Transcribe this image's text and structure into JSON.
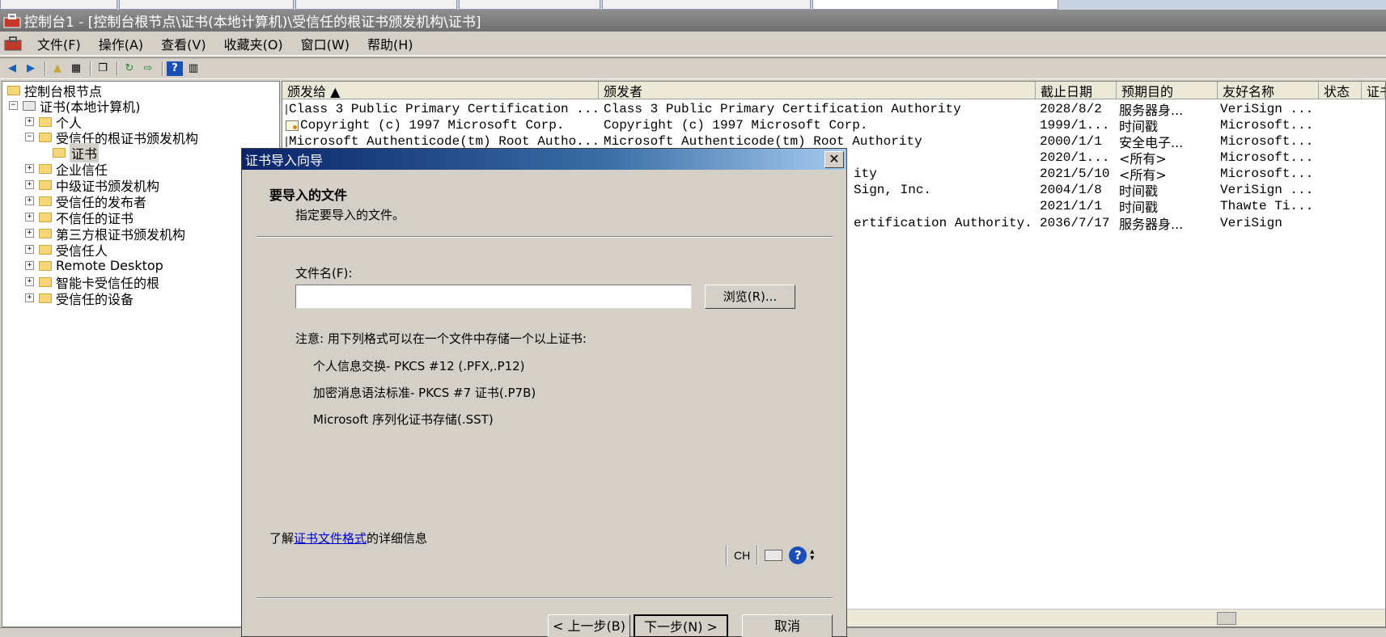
{
  "window": {
    "title": "控制台1 - [控制台根节点\\证书(本地计算机)\\受信任的根证书颁发机构\\证书]"
  },
  "menu": [
    "文件(F)",
    "操作(A)",
    "查看(V)",
    "收藏夹(O)",
    "窗口(W)",
    "帮助(H)"
  ],
  "tree": [
    {
      "label": "控制台根节点",
      "level": 0,
      "expander": "",
      "icon": "folder"
    },
    {
      "label": "证书(本地计算机)",
      "level": 1,
      "expander": "−",
      "icon": "cert-store"
    },
    {
      "label": "个人",
      "level": 2,
      "expander": "+",
      "icon": "folder"
    },
    {
      "label": "受信任的根证书颁发机构",
      "level": 2,
      "expander": "−",
      "icon": "folder"
    },
    {
      "label": "证书",
      "level": 3,
      "expander": "",
      "icon": "folder",
      "selected": true
    },
    {
      "label": "企业信任",
      "level": 2,
      "expander": "+",
      "icon": "folder"
    },
    {
      "label": "中级证书颁发机构",
      "level": 2,
      "expander": "+",
      "icon": "folder"
    },
    {
      "label": "受信任的发布者",
      "level": 2,
      "expander": "+",
      "icon": "folder"
    },
    {
      "label": "不信任的证书",
      "level": 2,
      "expander": "+",
      "icon": "folder"
    },
    {
      "label": "第三方根证书颁发机构",
      "level": 2,
      "expander": "+",
      "icon": "folder"
    },
    {
      "label": "受信任人",
      "level": 2,
      "expander": "+",
      "icon": "folder"
    },
    {
      "label": "Remote Desktop",
      "level": 2,
      "expander": "+",
      "icon": "folder"
    },
    {
      "label": "智能卡受信任的根",
      "level": 2,
      "expander": "+",
      "icon": "folder"
    },
    {
      "label": "受信任的设备",
      "level": 2,
      "expander": "+",
      "icon": "folder"
    }
  ],
  "columns": [
    "颁发给 ▲",
    "颁发者",
    "截止日期",
    "预期目的",
    "友好名称",
    "状态",
    "证书"
  ],
  "rows": [
    {
      "issued_to": "Class 3 Public Primary Certification ...",
      "issued_by": "Class 3 Public Primary Certification Authority",
      "expires": "2028/8/2",
      "purpose": "服务器身...",
      "friendly": "VeriSign ..."
    },
    {
      "issued_to": "Copyright (c) 1997 Microsoft Corp.",
      "issued_by": "Copyright (c) 1997 Microsoft Corp.",
      "expires": "1999/1...",
      "purpose": "时间戳",
      "friendly": "Microsoft..."
    },
    {
      "issued_to": "Microsoft Authenticode(tm) Root Autho...",
      "issued_by": "Microsoft Authenticode(tm) Root Authority",
      "expires": "2000/1/1",
      "purpose": "安全电子...",
      "friendly": "Microsoft..."
    },
    {
      "issued_to": "",
      "issued_by": "",
      "expires": "2020/1...",
      "purpose": "<所有>",
      "friendly": "Microsoft..."
    },
    {
      "issued_to": "",
      "issued_by": "ity",
      "expires": "2021/5/10",
      "purpose": "<所有>",
      "friendly": "Microsoft..."
    },
    {
      "issued_to": "",
      "issued_by": "Sign, Inc.",
      "expires": "2004/1/8",
      "purpose": "时间戳",
      "friendly": "VeriSign ..."
    },
    {
      "issued_to": "",
      "issued_by": "",
      "expires": "2021/1/1",
      "purpose": "时间戳",
      "friendly": "Thawte Ti..."
    },
    {
      "issued_to": "",
      "issued_by": "ertification Authority...",
      "expires": "2036/7/17",
      "purpose": "服务器身...",
      "friendly": "VeriSign"
    }
  ],
  "dialog": {
    "title": "证书导入向导",
    "heading": "要导入的文件",
    "subheading": "指定要导入的文件。",
    "file_label": "文件名(F):",
    "file_value": "",
    "browse": "浏览(R)...",
    "note": "注意: 用下列格式可以在一个文件中存储一个以上证书:",
    "formats": [
      "个人信息交换- PKCS #12 (.PFX,.P12)",
      "加密消息语法标准- PKCS #7 证书(.P7B)",
      "Microsoft 序列化证书存储(.SST)"
    ],
    "learn_prefix": "了解",
    "learn_link": "证书文件格式",
    "learn_suffix": "的详细信息",
    "lang": "CH",
    "back": "< 上一步(B)",
    "next": "下一步(N) >",
    "cancel": "取消"
  }
}
